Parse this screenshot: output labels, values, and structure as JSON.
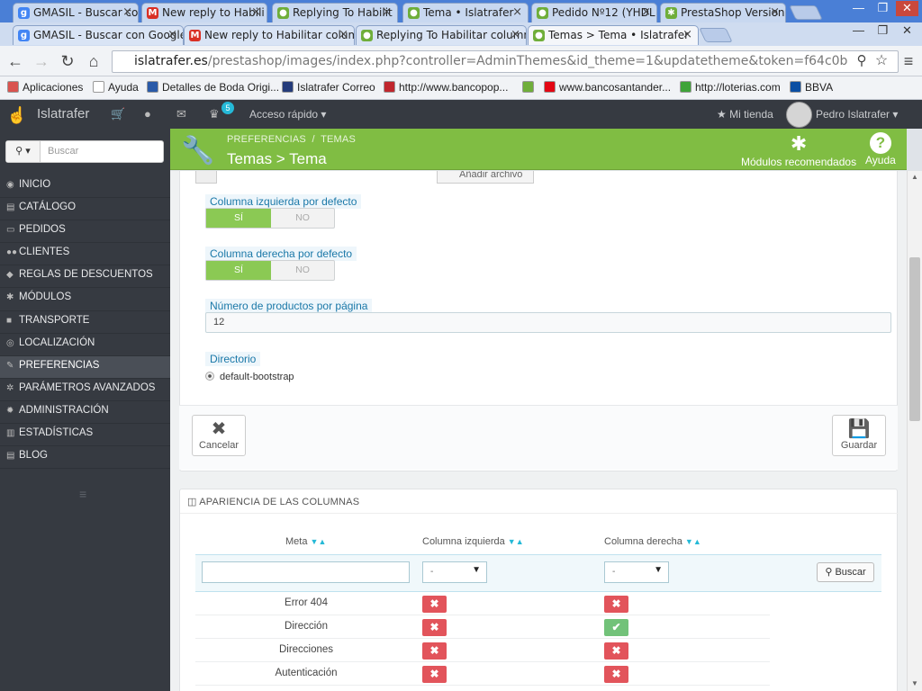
{
  "browser": {
    "outer_tabs": [
      {
        "label": "GMASIL - Buscar co",
        "icon": "google-icon",
        "color": "#4285f4"
      },
      {
        "label": "New reply to Habili",
        "icon": "gmail-icon",
        "color": "#d93025"
      },
      {
        "label": "Replying To Habilit",
        "icon": "prestashop-icon",
        "color": "#6fae3a"
      },
      {
        "label": "Tema • Islatrafer",
        "icon": "prestashop-icon",
        "color": "#6fae3a"
      },
      {
        "label": "Pedido Nº12 (YHDL",
        "icon": "prestashop-icon",
        "color": "#6fae3a"
      },
      {
        "label": "PrestaShop Version",
        "icon": "puzzle-icon",
        "color": "#6fae3a"
      }
    ],
    "inner_tabs": [
      {
        "label": "GMASIL - Buscar con Google",
        "icon": "google-icon",
        "color": "#4285f4"
      },
      {
        "label": "New reply to Habilitar columr",
        "icon": "gmail-icon",
        "color": "#d93025"
      },
      {
        "label": "Replying To Habilitar column",
        "icon": "prestashop-icon",
        "color": "#6fae3a"
      },
      {
        "label": "Temas > Tema • Islatrafer",
        "icon": "prestashop-icon",
        "color": "#6fae3a"
      }
    ],
    "url_domain": "islatrafer.es",
    "url_rest": "/prestashop/images/index.php?controller=AdminThemes&id_theme=1&updatetheme&token=f64c0b",
    "bookmarks": [
      {
        "label": "Aplicaciones",
        "color": "#d9534f"
      },
      {
        "label": "Ayuda",
        "color": "#ffffff"
      },
      {
        "label": "Detalles de Boda Origi...",
        "color": "#2a5aa8"
      },
      {
        "label": "Islatrafer Correo",
        "color": "#243b7a"
      },
      {
        "label": "http://www.bancopop...",
        "color": "#c0262d"
      },
      {
        "label": "",
        "color": "#6fae3a"
      },
      {
        "label": "www.bancosantander...",
        "color": "#e30613"
      },
      {
        "label": "http://loterias.com",
        "color": "#3ea338"
      },
      {
        "label": "BBVA",
        "color": "#0a4ea3"
      }
    ]
  },
  "admin": {
    "brand": "Islatrafer",
    "notifications": "5",
    "quick_access": "Acceso rápido ▾",
    "my_shop": "Mi tienda",
    "user": "Pedro Islatrafer ▾",
    "search_placeholder": "Buscar",
    "menu": [
      {
        "label": "INICIO",
        "icon": "dashboard-icon"
      },
      {
        "label": "CATÁLOGO",
        "icon": "book-icon"
      },
      {
        "label": "PEDIDOS",
        "icon": "credit-card-icon"
      },
      {
        "label": "CLIENTES",
        "icon": "users-icon"
      },
      {
        "label": "REGLAS DE DESCUENTOS",
        "icon": "tag-icon"
      },
      {
        "label": "MÓDULOS",
        "icon": "puzzle-icon"
      },
      {
        "label": "TRANSPORTE",
        "icon": "truck-icon"
      },
      {
        "label": "LOCALIZACIÓN",
        "icon": "globe-icon"
      },
      {
        "label": "PREFERENCIAS",
        "icon": "wrench-icon",
        "active": true
      },
      {
        "label": "PARÁMETROS AVANZADOS",
        "icon": "cogs-icon"
      },
      {
        "label": "ADMINISTRACIÓN",
        "icon": "cog-icon"
      },
      {
        "label": "ESTADÍSTICAS",
        "icon": "bar-chart-icon"
      },
      {
        "label": "BLOG",
        "icon": "book-icon"
      }
    ]
  },
  "header": {
    "crumb_1": "PREFERENCIAS",
    "crumb_sep": "/",
    "crumb_2": "TEMAS",
    "title": "Temas > Tema",
    "btn_modules": "Módulos recomendados",
    "btn_help": "Ayuda"
  },
  "form": {
    "hidden_file_btn": "Añadir archivo",
    "left_column_label": "Columna izquierda por defecto",
    "right_column_label": "Columna derecha por defecto",
    "yes": "SÍ",
    "no": "NO",
    "products_label": "Número de productos por página",
    "products_value": "12",
    "directory_label": "Directorio",
    "directory_value": "default-bootstrap",
    "cancel": "Cancelar",
    "save": "Guardar"
  },
  "columns_panel": {
    "title": "APARIENCIA DE LAS COLUMNAS",
    "headers": [
      "Meta",
      "Columna izquierda",
      "Columna derecha"
    ],
    "filter_select": "-",
    "search_button": "Buscar",
    "rows": [
      {
        "meta": "Error 404",
        "left": false,
        "right": false
      },
      {
        "meta": "Dirección",
        "left": false,
        "right": true
      },
      {
        "meta": "Direcciones",
        "left": false,
        "right": false
      },
      {
        "meta": "Autenticación",
        "left": false,
        "right": false
      }
    ]
  }
}
